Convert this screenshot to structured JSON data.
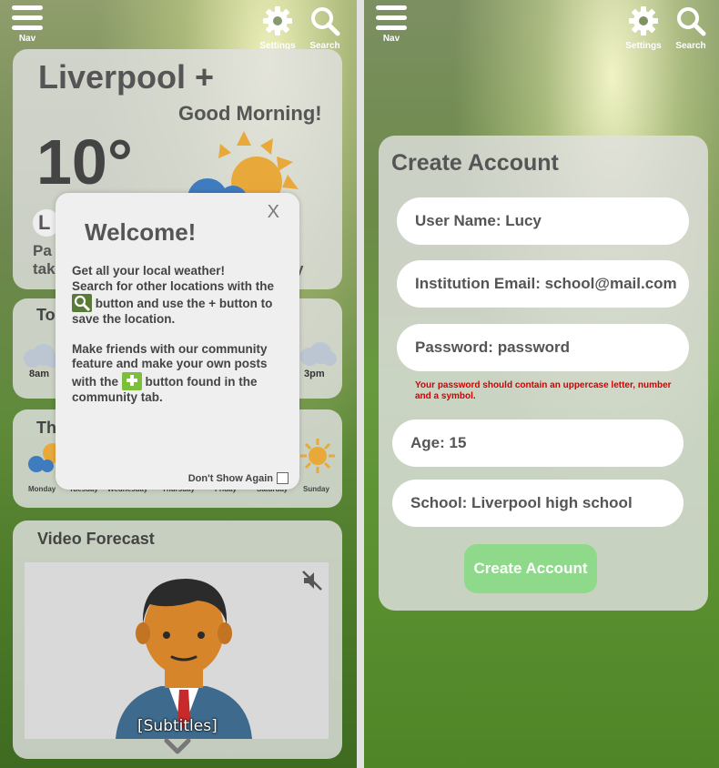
{
  "topbar": {
    "nav_label": "Nav",
    "settings_label": "Settings",
    "search_label": "Search"
  },
  "weather": {
    "city": "Liverpool +",
    "greeting": "Good Morning!",
    "temperature": "10°",
    "partial_badge": "L",
    "partial_line1": "Pa",
    "partial_line2": "tak",
    "partial_line2_end": "y"
  },
  "today": {
    "title": "To",
    "times": [
      "8am",
      "3pm"
    ]
  },
  "week": {
    "title": "Th",
    "days": [
      "Monday",
      "Tuesday",
      "Wednesday",
      "Thursday",
      "Friday",
      "Saturday",
      "Sunday"
    ]
  },
  "welcome_modal": {
    "title": "Welcome!",
    "close": "X",
    "line1": "Get all your local weather!",
    "line2": "Search for other locations with the",
    "line3": "button and use the + button to save the location.",
    "line4": "Make friends with our community feature and make your own posts with the",
    "line5": "button found in the community tab.",
    "dont_show": "Don't Show Again"
  },
  "video": {
    "title": "Video Forecast",
    "subtitles": "[Subtitles]"
  },
  "create_account": {
    "title": "Create Account",
    "username": "User Name: Lucy",
    "email": "Institution Email: school@mail.com",
    "password": "Password: password",
    "password_warning": "Your password should contain an uppercase letter, number and a symbol.",
    "age": "Age: 15",
    "school": "School: Liverpool high school",
    "submit": "Create Account"
  },
  "colors": {
    "accent_green": "#8fd98a",
    "warning_red": "#d40000",
    "sun": "#e9a93a",
    "cloud": "#3f7bbf"
  }
}
